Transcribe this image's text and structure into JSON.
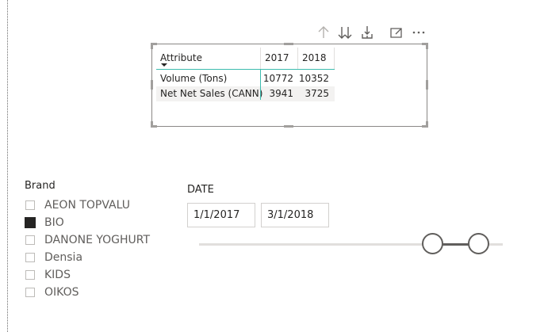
{
  "toolbar": {
    "icons": [
      "drill-up-icon",
      "drill-down-all-icon",
      "expand-hierarchy-icon",
      "focus-mode-icon",
      "more-options-icon"
    ]
  },
  "matrix": {
    "headers": [
      "Attribute",
      "2017",
      "2018"
    ],
    "rows": [
      {
        "label": "Volume (Tons)",
        "v2017": "10772",
        "v2018": "10352"
      },
      {
        "label": "Net Net Sales (CANN)",
        "v2017": "3941",
        "v2018": "3725"
      }
    ],
    "accent_color": "#3cbcaf"
  },
  "brand_slicer": {
    "title": "Brand",
    "items": [
      {
        "label": "AEON TOPVALU",
        "checked": false
      },
      {
        "label": "BIO",
        "checked": true
      },
      {
        "label": "DANONE YOGHURT",
        "checked": false
      },
      {
        "label": "Densia",
        "checked": false
      },
      {
        "label": "KIDS",
        "checked": false
      },
      {
        "label": "OIKOS",
        "checked": false
      }
    ]
  },
  "date_slicer": {
    "title": "DATE",
    "start": "1/1/2017",
    "end": "3/1/2018",
    "range_fraction": {
      "start": 0.77,
      "end": 0.92
    }
  }
}
